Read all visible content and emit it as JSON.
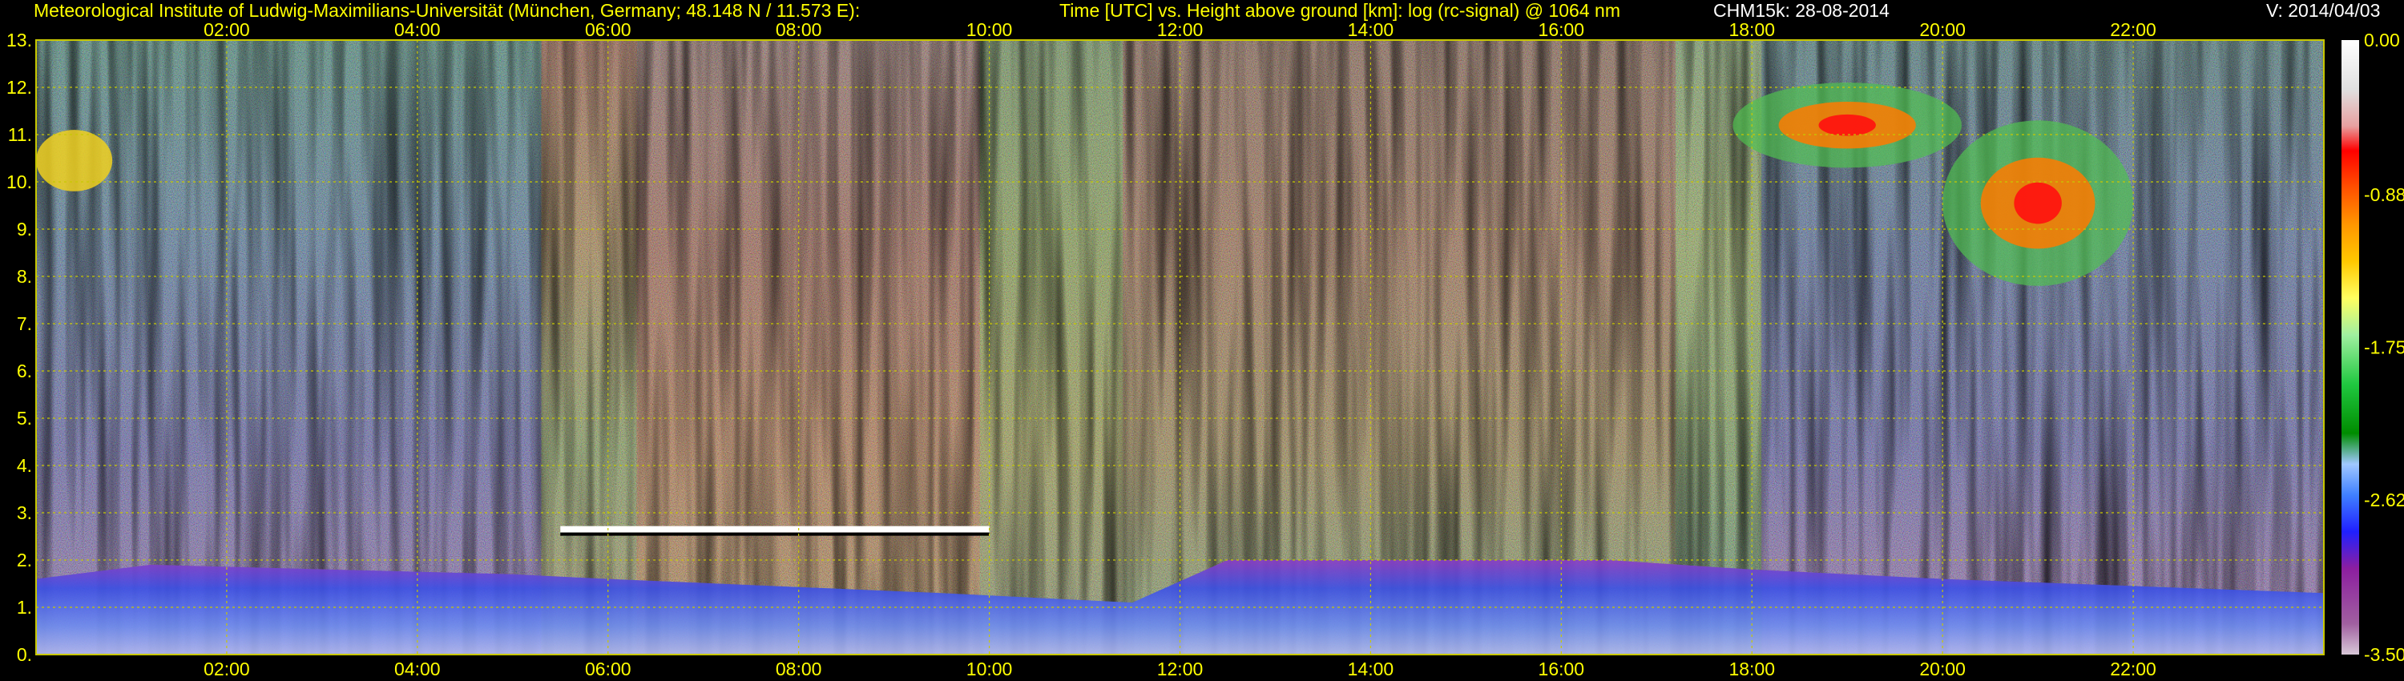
{
  "header": {
    "institute": "Meteorological Institute of Ludwig-Maximilians-Universität (München, Germany; 48.148 N / 11.573 E):",
    "title": "Time [UTC] vs. Height above ground [km]: log (rc-signal) @ 1064 nm",
    "instrument": "CHM15k: 28-08-2014",
    "version": "V: 2014/04/03"
  },
  "colors": {
    "label_yellow": "#ffff00",
    "grid_yellow": "#c8c800",
    "background": "#000000"
  },
  "chart_data": {
    "type": "heatmap",
    "title": "Time [UTC] vs. Height above ground [km]: log (rc-signal) @ 1064 nm",
    "xlabel": "",
    "ylabel": "",
    "x_unit": "hours UTC",
    "xlim": [
      0,
      24
    ],
    "ylim": [
      0,
      13
    ],
    "x_ticks": [
      2,
      4,
      6,
      8,
      10,
      12,
      14,
      16,
      18,
      20,
      22
    ],
    "x_tick_labels": [
      "02:00",
      "04:00",
      "06:00",
      "08:00",
      "10:00",
      "12:00",
      "14:00",
      "16:00",
      "18:00",
      "20:00",
      "22:00"
    ],
    "y_ticks": [
      0,
      1,
      2,
      3,
      4,
      5,
      6,
      7,
      8,
      9,
      10,
      11,
      12,
      13
    ],
    "y_tick_labels": [
      "0.",
      "1.",
      "2.",
      "3.",
      "4.",
      "5.",
      "6.",
      "7.",
      "8.",
      "9.",
      "10.",
      "11.",
      "12.",
      "13."
    ],
    "grid": true,
    "colorbar": {
      "min": -3.5,
      "max": 0.0,
      "ticks": [
        0.0,
        -0.88,
        -1.75,
        -2.62,
        -3.5
      ],
      "tick_labels": [
        "0.00",
        "-0.88",
        "-1.75",
        "-2.62",
        "-3.50"
      ]
    },
    "features": {
      "boundary_layer": [
        {
          "hour": 0.0,
          "km": 1.6
        },
        {
          "hour": 1.2,
          "km": 1.9
        },
        {
          "hour": 5.0,
          "km": 1.7
        },
        {
          "hour": 6.0,
          "km": 1.6
        },
        {
          "hour": 9.5,
          "km": 1.3
        },
        {
          "hour": 11.5,
          "km": 1.1
        },
        {
          "hour": 12.5,
          "km": 2.0
        },
        {
          "hour": 16.5,
          "km": 2.0
        },
        {
          "hour": 18.0,
          "km": 1.8
        },
        {
          "hour": 20.0,
          "km": 1.6
        },
        {
          "hour": 24.0,
          "km": 1.3
        }
      ],
      "cloud_layer_low": {
        "start_hour": 5.5,
        "end_hour": 10.0,
        "km": 2.65
      },
      "cirrus_early": {
        "start_hour": 0.0,
        "end_hour": 0.8,
        "km_bottom": 9.8,
        "km_top": 11.1
      },
      "cirrus_evening": [
        {
          "start_hour": 17.8,
          "end_hour": 20.2,
          "km_bottom": 10.3,
          "km_top": 12.1
        },
        {
          "start_hour": 20.0,
          "end_hour": 22.0,
          "km_bottom": 7.8,
          "km_top": 11.3
        }
      ],
      "solar_noise_hours": [
        5.3,
        18.0
      ]
    }
  }
}
